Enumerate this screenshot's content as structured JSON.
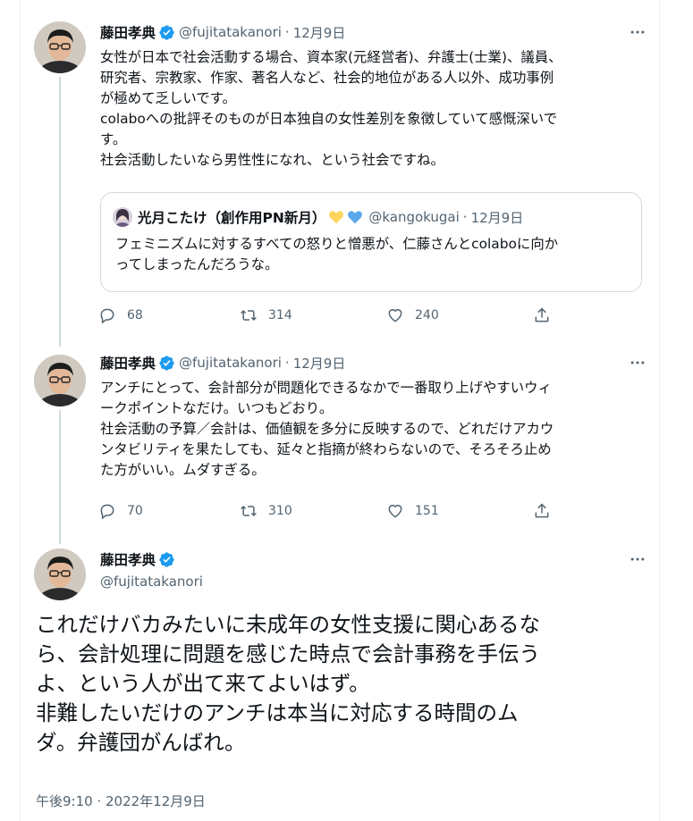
{
  "author": {
    "name": "藤田孝典",
    "handle": "@fujitatakanori"
  },
  "separator": "·",
  "tweets": [
    {
      "date": "12月9日",
      "lines": [
        "女性が日本で社会活動する場合、資本家(元経営者)、弁護士(士業)、議員、",
        "研究者、宗教家、作家、著名人など、社会的地位がある人以外、成功事例",
        "が極めて乏しいです。",
        "colaboへの批評そのものが日本独自の女性差別を象徴していて感慨深いで",
        "す。",
        "社会活動したいなら男性性になれ、という社会ですね。"
      ],
      "quote": {
        "name": "光月こたけ（創作用PN新月）",
        "handle": "@kangokugai",
        "date": "12月9日",
        "heart_colors": [
          "#ffd45c",
          "#5aa8ec"
        ],
        "lines": [
          "フェミニズムに対するすべての怒りと憎悪が、仁藤さんとcolaboに向か",
          "ってしまったんだろうな。"
        ]
      },
      "replies": "68",
      "retweets": "314",
      "likes": "240"
    },
    {
      "date": "12月9日",
      "lines": [
        "アンチにとって、会計部分が問題化できるなかで一番取り上げやすいウィ",
        "ークポイントなだけ。いつもどおり。",
        "社会活動の予算／会計は、価値観を多分に反映するので、どれだけアカウ",
        "ンタビリティを果たしても、延々と指摘が終わらないので、そろそろ止め",
        "た方がいい。ムダすぎる。"
      ],
      "replies": "70",
      "retweets": "310",
      "likes": "151"
    }
  ],
  "main_tweet": {
    "lines": [
      "これだけバカみたいに未成年の女性支援に関心あるな",
      "ら、会計処理に問題を感じた時点で会計事務を手伝う",
      "よ、という人が出て来てよいはず。",
      "非難したいだけのアンチは本当に対応する時間のム",
      "ダ。弁護団がんばれ。"
    ],
    "timestamp": "午後9:10 · 2022年12月9日"
  },
  "colors": {
    "verified": "#1d9bf0",
    "secondary_text": "#536471",
    "thread_line": "#cfd9de"
  },
  "icons": {
    "verified": "verified-badge-icon",
    "more": "more-horizontal-icon",
    "reply": "reply-icon",
    "retweet": "retweet-icon",
    "like": "heart-icon",
    "share": "share-icon"
  }
}
